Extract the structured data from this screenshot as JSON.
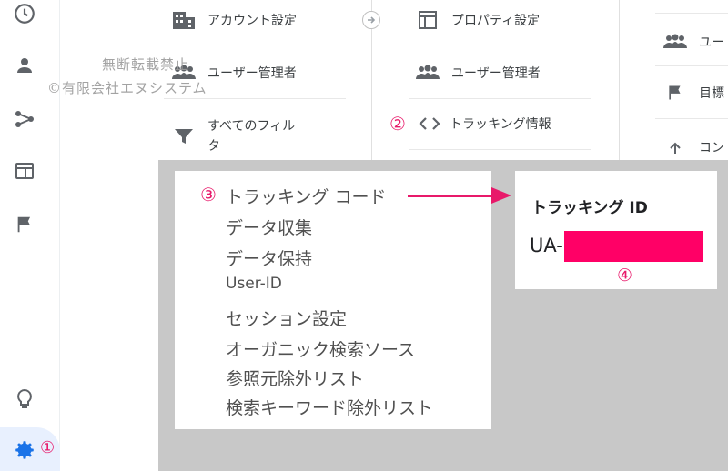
{
  "rail": {
    "icons": [
      "clock-icon",
      "person-icon",
      "share-icon",
      "dashboard-icon",
      "flag-icon",
      "lightbulb-icon",
      "gear-icon"
    ]
  },
  "account_column": {
    "items": [
      {
        "label": "アカウント設定",
        "icon": "building-icon"
      },
      {
        "label": "ユーザー管理者",
        "icon": "people-icon"
      },
      {
        "label": "すべてのフィル",
        "label2": "タ",
        "icon": "filter-icon"
      }
    ]
  },
  "property_column": {
    "items": [
      {
        "label": "プロパティ設定",
        "icon": "layout-icon"
      },
      {
        "label": "ユーザー管理者",
        "icon": "people-icon"
      },
      {
        "label": "トラッキング情報",
        "icon": "code-icon"
      }
    ]
  },
  "view_column": {
    "items": [
      {
        "label": "ユー",
        "icon": "people-icon"
      },
      {
        "label": "目標",
        "icon": "flag-icon"
      },
      {
        "label": "コン",
        "icon": "arrow-icon"
      }
    ]
  },
  "watermark": {
    "line1": "無断転載禁止",
    "line2": "©有限会社エヌシステム"
  },
  "annotations": {
    "n1": "①",
    "n2": "②",
    "n3": "③",
    "n4": "④"
  },
  "tracking_menu": {
    "items": [
      "トラッキング コード",
      "データ収集",
      "データ保持",
      "User-ID",
      "セッション設定",
      "オーガニック検索ソース",
      "参照元除外リスト",
      "検索キーワード除外リスト"
    ]
  },
  "tracking_id_panel": {
    "title": "トラッキング ID",
    "prefix": "UA-",
    "redaction_color": "#ff0066"
  },
  "colors": {
    "accent": "#e8196a",
    "nav_blue": "#1a73e8",
    "icon_gray": "#5f6368"
  }
}
